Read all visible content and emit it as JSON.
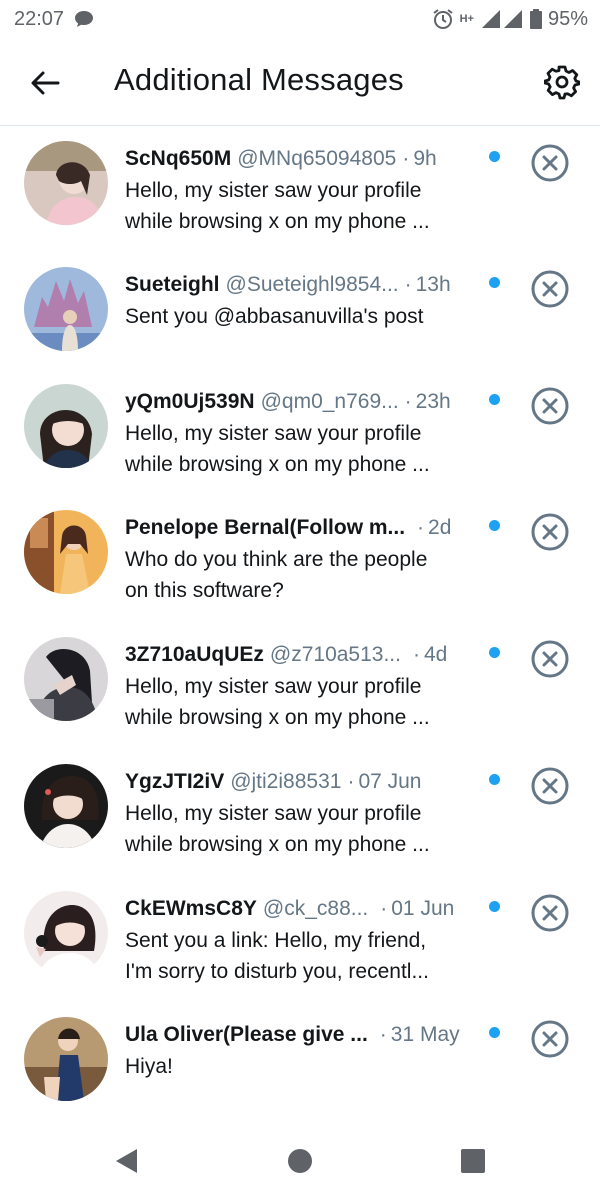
{
  "status": {
    "time": "22:07",
    "network": "H+",
    "battery": "95%"
  },
  "header": {
    "title": "Additional Messages"
  },
  "messages": [
    {
      "name": "ScNq650M",
      "handle": "@MNq65094805",
      "time": "9h",
      "line1": "Hello, my sister saw your profile",
      "line2": "while browsing x on my phone ..."
    },
    {
      "name": "Sueteighl",
      "handle": "@Sueteighl9854...",
      "time": "13h",
      "line1": "Sent you @abbasanuvilla's post",
      "line2": ""
    },
    {
      "name": "yQm0Uj539N",
      "handle": "@qm0_n769...",
      "time": "23h",
      "line1": "Hello, my sister saw your profile",
      "line2": "while browsing x on my phone ..."
    },
    {
      "name": "Penelope Bernal(Follow m...",
      "handle": "",
      "time": "2d",
      "line1": "Who do you think are the people",
      "line2": "on this software?"
    },
    {
      "name": "3Z710aUqUEz",
      "handle": "@z710a513...",
      "time": "4d",
      "line1": "Hello, my sister saw your profile",
      "line2": "while browsing x on my phone ..."
    },
    {
      "name": "YgzJTI2iV",
      "handle": "@jti2i88531",
      "time": "07 Jun",
      "line1": "Hello, my sister saw your profile",
      "line2": "while browsing x on my phone ..."
    },
    {
      "name": "CkEWmsC8Y",
      "handle": "@ck_c88...",
      "time": "01 Jun",
      "line1": "Sent you a link: Hello, my friend,",
      "line2": "I'm sorry to disturb you, recentl..."
    },
    {
      "name": "Ula Oliver(Please give ...",
      "handle": "",
      "time": "31 May",
      "line1": "Hiya!",
      "line2": ""
    }
  ],
  "colors": {
    "accent": "#1da1f2",
    "secondary_text": "#657786",
    "icon": "#657786"
  },
  "icons": {
    "back": "arrow-left-icon",
    "settings": "gear-icon",
    "dismiss": "close-circle-icon",
    "nav": [
      "back-triangle-icon",
      "home-circle-icon",
      "recents-square-icon"
    ]
  }
}
